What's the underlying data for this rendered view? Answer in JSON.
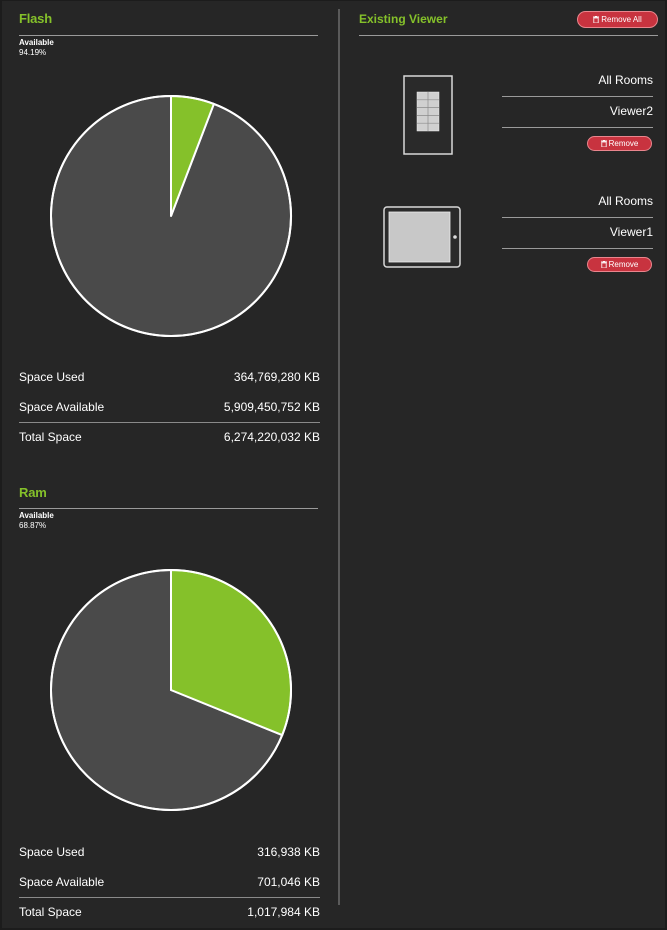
{
  "colors": {
    "accent": "#85c12a",
    "used_slice": "#4a4a4a",
    "remove_button": "#c8333f",
    "background": "#262626"
  },
  "flash": {
    "title": "Flash",
    "available_label": "Available",
    "available_pct": "94.19%",
    "rows": [
      {
        "label": "Space Used",
        "value": "364,769,280 KB"
      },
      {
        "label": "Space Available",
        "value": "5,909,450,752 KB"
      },
      {
        "label": "Total Space",
        "value": "6,274,220,032 KB"
      }
    ]
  },
  "ram": {
    "title": "Ram",
    "available_label": "Available",
    "available_pct": "68.87%",
    "rows": [
      {
        "label": "Space Used",
        "value": "316,938 KB"
      },
      {
        "label": "Space Available",
        "value": "701,046 KB"
      },
      {
        "label": "Total Space",
        "value": "1,017,984 KB"
      }
    ]
  },
  "chart_data": [
    {
      "type": "pie",
      "categories": [
        "Used",
        "Available"
      ],
      "values": [
        364769280,
        5909450752
      ],
      "colors": [
        "#85c12a",
        "#4a4a4a"
      ]
    },
    {
      "type": "pie",
      "categories": [
        "Used",
        "Available"
      ],
      "values": [
        316938,
        701046
      ],
      "colors": [
        "#85c12a",
        "#4a4a4a"
      ]
    }
  ],
  "viewer": {
    "title": "Existing Viewer",
    "remove_all_label": "Remove All",
    "items": [
      {
        "room": "All Rooms",
        "name": "Viewer2",
        "device_icon": "keypad-device-icon",
        "remove_label": "Remove"
      },
      {
        "room": "All Rooms",
        "name": "Viewer1",
        "device_icon": "tablet-device-icon",
        "remove_label": "Remove"
      }
    ]
  }
}
